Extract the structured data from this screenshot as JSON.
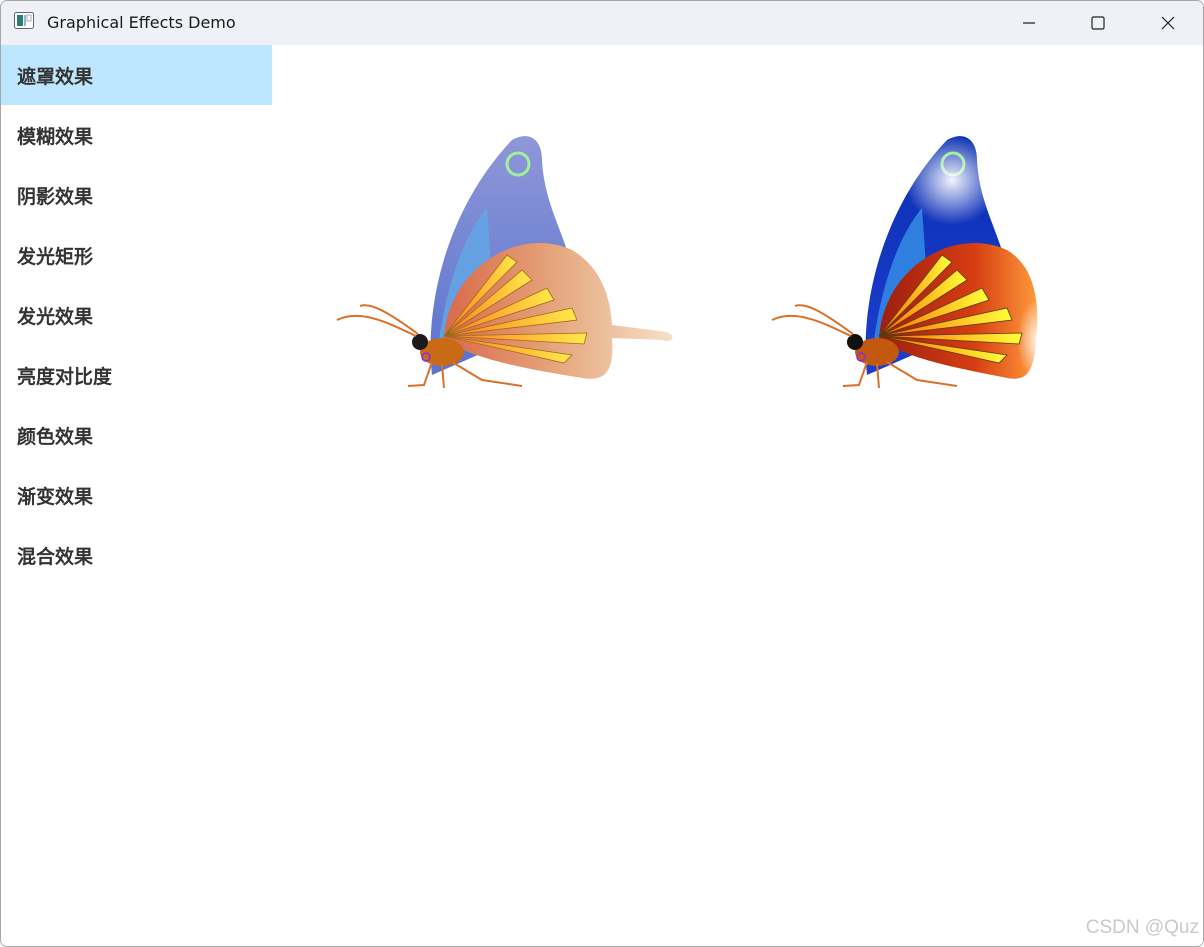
{
  "window": {
    "title": "Graphical Effects Demo"
  },
  "caption": {
    "minimize_icon": "minimize-icon",
    "maximize_icon": "maximize-icon",
    "close_icon": "close-icon"
  },
  "sidebar": {
    "items": [
      {
        "label": "遮罩效果",
        "active": true
      },
      {
        "label": "模糊效果"
      },
      {
        "label": "阴影效果"
      },
      {
        "label": "发光矩形"
      },
      {
        "label": "发光效果"
      },
      {
        "label": "亮度对比度"
      },
      {
        "label": "颜色效果"
      },
      {
        "label": "渐变效果"
      },
      {
        "label": "混合效果"
      }
    ]
  },
  "colors": {
    "active_item_bg": "#bfe6ff",
    "titlebar_bg": "#eff1f6",
    "text": "#333333"
  },
  "watermark": "CSDN @Quz"
}
